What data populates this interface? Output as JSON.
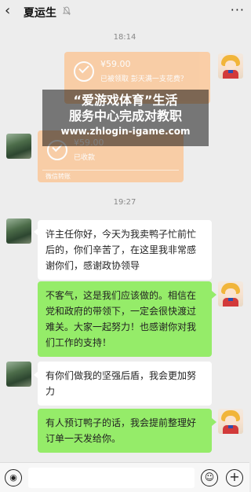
{
  "header": {
    "back_icon": "chevron-left-icon",
    "title": "夏运生",
    "more_label": "···"
  },
  "timestamps": [
    "18:14",
    "19:27"
  ],
  "transfers": [
    {
      "amount": "¥59.00",
      "status": "已被领取  彭天满一支花费？",
      "foot": ""
    },
    {
      "amount": "¥59.00",
      "status": "已收款",
      "foot": "微信转账"
    }
  ],
  "watermark": {
    "line1": "“爱游戏体育”生活",
    "line2": "服务中心完成对教职",
    "line3": "www.zhlogin-igame.com"
  },
  "messages": [
    {
      "side": "in",
      "text": "许主任你好，今天为我卖鸭子忙前忙后的，你们辛苦了，在这里我非常感谢你们，感谢政协领导"
    },
    {
      "side": "out",
      "text": "不客气，这是我们应该做的。相信在党和政府的带领下，一定会很快渡过难关。大家一起努力！也感谢你对我们工作的支持！"
    },
    {
      "side": "in",
      "text": "有你们做我的坚强后盾，我会更加努力"
    },
    {
      "side": "out",
      "text": "有人预订鸭子的话，我会提前整理好订单一天发给你。"
    }
  ],
  "inputbar": {
    "voice_label": "◉",
    "emoji_label": "☺",
    "plus_label": "+"
  },
  "colors": {
    "background": "#ededed",
    "bubble_out": "#95ec69",
    "bubble_in": "#ffffff",
    "transfer": "#fbc89a"
  }
}
